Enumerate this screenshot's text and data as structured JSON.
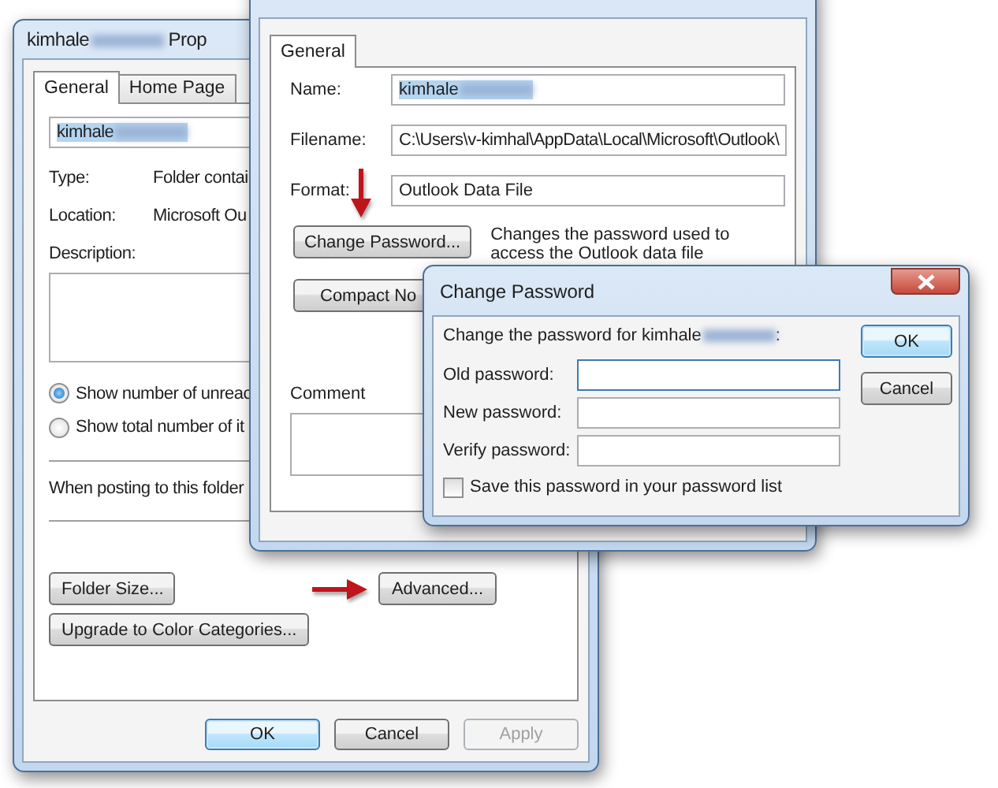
{
  "properties_window": {
    "title": {
      "name": "kimhale",
      "redacted": true,
      "suffix": "Prop"
    },
    "tabs": [
      {
        "label": "General",
        "selected": true
      },
      {
        "label": "Home Page",
        "selected": false
      }
    ],
    "name_field": {
      "value": "kimhale",
      "redacted": true,
      "highlighted": true
    },
    "details": [
      {
        "label": "Type:",
        "value": "Folder contai"
      },
      {
        "label": "Location:",
        "value": "Microsoft Ou"
      }
    ],
    "description": {
      "label": "Description:"
    },
    "radios": [
      {
        "label": "Show number of unreac",
        "selected": true
      },
      {
        "label": "Show total number of it",
        "selected": false
      }
    ],
    "posting_label": "When posting to this folder",
    "buttons": [
      {
        "label": "Folder Size...",
        "pointer_arrow": false
      },
      {
        "label": "Advanced...",
        "pointer_arrow": true
      }
    ],
    "upgrade_button": "Upgrade to Color Categories...",
    "footer_buttons": [
      {
        "label": "OK",
        "default": true,
        "disabled": false
      },
      {
        "label": "Cancel",
        "default": false,
        "disabled": false
      },
      {
        "label": "Apply",
        "default": false,
        "disabled": true
      }
    ]
  },
  "data_file_window": {
    "tabs": [
      {
        "label": "General",
        "selected": true
      }
    ],
    "fields": [
      {
        "label": "Name:",
        "value": "kimhale",
        "redacted": true,
        "highlighted": true
      },
      {
        "label": "Filename:",
        "value": "C:\\Users\\v-kimhal\\AppData\\Local\\Microsoft\\Outlook\\",
        "redacted": false,
        "highlighted": false
      },
      {
        "label": "Format:",
        "value": "Outlook Data File",
        "redacted": false,
        "highlighted": false
      }
    ],
    "change_password_button": {
      "label": "Change Password...",
      "pointer_arrow": true
    },
    "change_password_note": "Changes the password used to access the Outlook data file",
    "compact_button": "Compact No",
    "comment": {
      "label": "Comment"
    }
  },
  "change_password_window": {
    "title": "Change Password",
    "prompt": {
      "text": "Change the password for kimhale",
      "redacted": true,
      "suffix": ":"
    },
    "fields": [
      {
        "label": "Old password:",
        "focused": true
      },
      {
        "label": "New password:",
        "focused": false
      },
      {
        "label": "Verify password:",
        "focused": false
      }
    ],
    "save_checkbox": {
      "label": "Save this password in your password list",
      "checked": false
    },
    "buttons": [
      {
        "label": "OK",
        "default": true
      },
      {
        "label": "Cancel",
        "default": false
      }
    ]
  }
}
